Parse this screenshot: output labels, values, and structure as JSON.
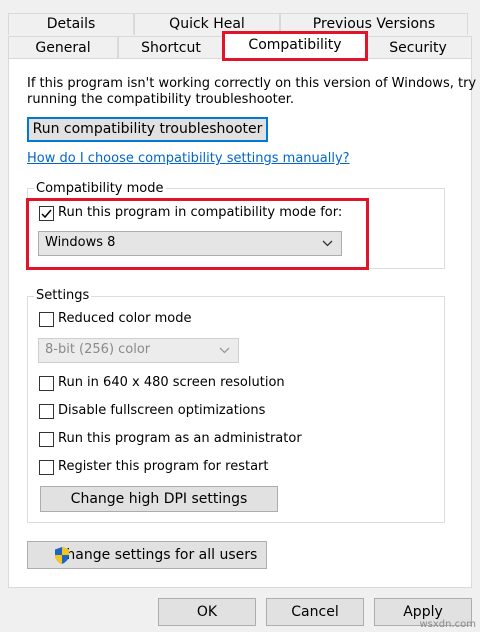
{
  "tabs": {
    "row1": [
      "Details",
      "Quick Heal",
      "Previous Versions"
    ],
    "row2": [
      "General",
      "Shortcut",
      "Compatibility",
      "Security"
    ]
  },
  "intro_text_1": "If this program isn't working correctly on this version of Windows, try",
  "intro_text_2": "running the compatibility troubleshooter.",
  "run_troubleshooter_label": "Run compatibility troubleshooter",
  "help_link": "How do I choose compatibility settings manually?",
  "compat_mode": {
    "legend": "Compatibility mode",
    "checkbox_label": "Run this program in compatibility mode for:",
    "checked": true,
    "selected_os": "Windows 8"
  },
  "settings": {
    "legend": "Settings",
    "reduced_color": "Reduced color mode",
    "color_option": "8-bit (256) color",
    "res_640": "Run in 640 x 480 screen resolution",
    "disable_fullscreen": "Disable fullscreen optimizations",
    "run_admin": "Run this program as an administrator",
    "register_restart": "Register this program for restart",
    "dpi_button": "Change high DPI settings"
  },
  "all_users_button": "Change settings for all users",
  "footer": {
    "ok": "OK",
    "cancel": "Cancel",
    "apply": "Apply"
  },
  "watermark": "wsxdn.com",
  "colors": {
    "highlight": "#e0142b",
    "link": "#0066cc",
    "focus": "#0078d7"
  }
}
